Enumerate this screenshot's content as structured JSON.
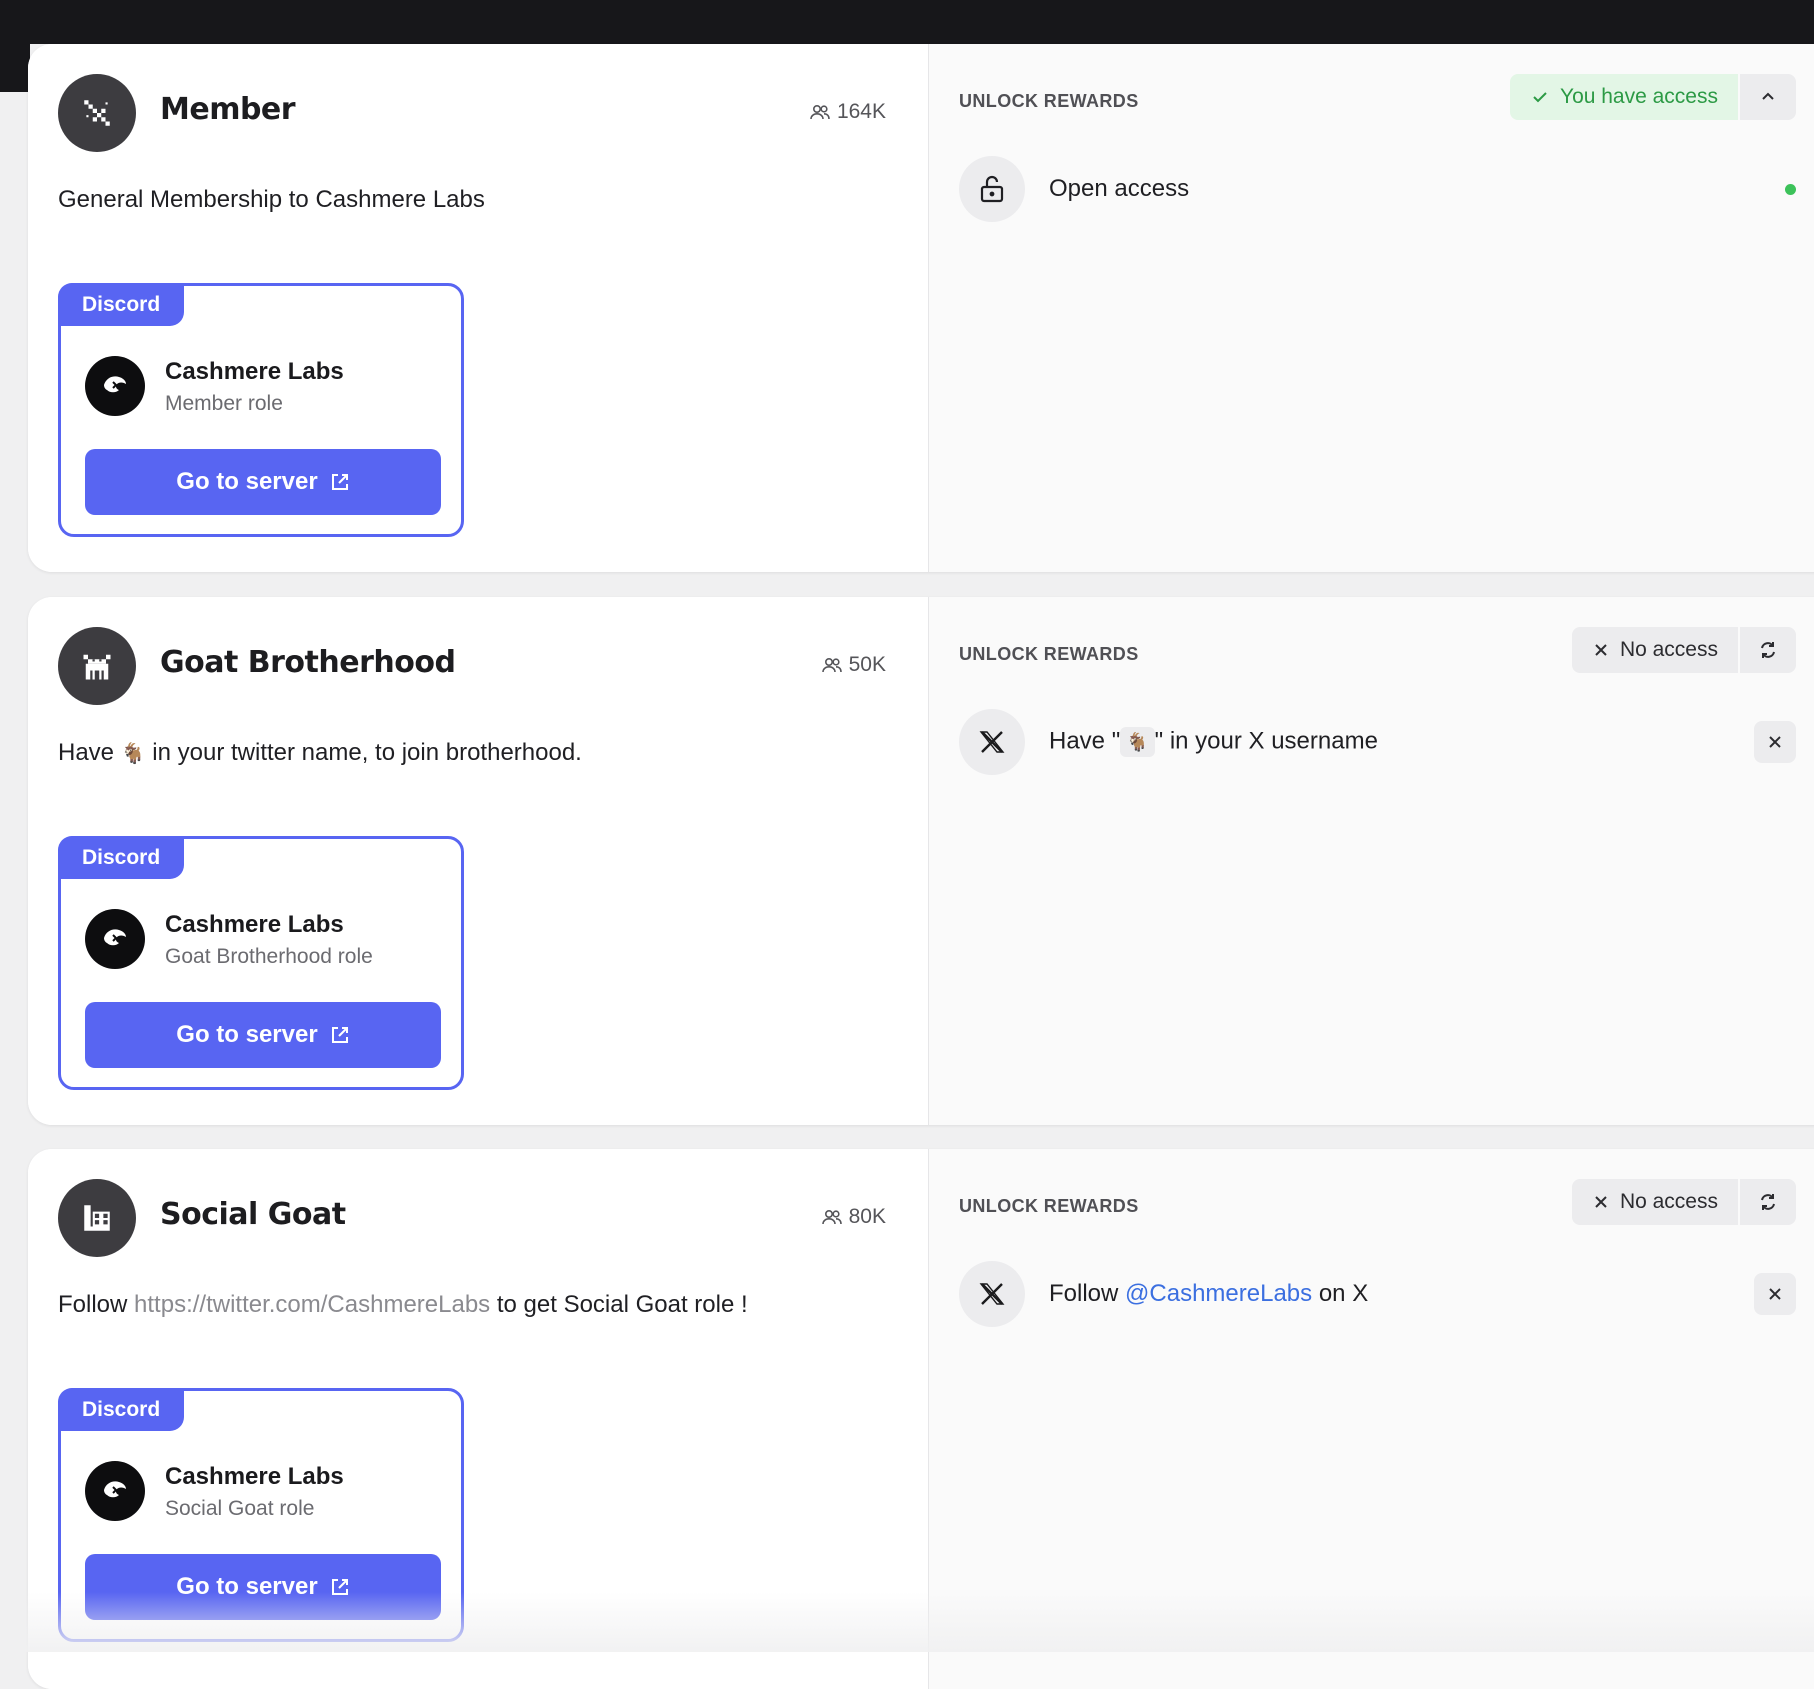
{
  "unlock_label": "UNLOCK REWARDS",
  "roles": [
    {
      "name": "Member",
      "member_count": "164K",
      "description": "General Membership to Cashmere Labs",
      "reward": {
        "platform": "Discord",
        "server_name": "Cashmere Labs",
        "server_role": "Member role",
        "button_label": "Go to server"
      },
      "status": {
        "kind": "access",
        "label": "You have access"
      },
      "requirement": {
        "type": "open",
        "text": "Open access"
      }
    },
    {
      "name": "Goat Brotherhood",
      "member_count": "50K",
      "description_before": "Have",
      "description_emoji": "🐐",
      "description_after": "in your twitter name, to join brotherhood.",
      "reward": {
        "platform": "Discord",
        "server_name": "Cashmere Labs",
        "server_role": "Goat Brotherhood role",
        "button_label": "Go to server"
      },
      "status": {
        "kind": "no-access",
        "label": "No access"
      },
      "requirement": {
        "type": "x",
        "text_before": "Have \"",
        "emoji": "🐐",
        "text_after": "\" in your X username"
      }
    },
    {
      "name": "Social Goat",
      "member_count": "80K",
      "description_before": "Follow",
      "description_link": "https://twitter.com/CashmereLabs",
      "description_after": "to get Social Goat role !",
      "reward": {
        "platform": "Discord",
        "server_name": "Cashmere Labs",
        "server_role": "Social Goat role",
        "button_label": "Go to server"
      },
      "status": {
        "kind": "no-access",
        "label": "No access"
      },
      "requirement": {
        "type": "x",
        "text_before": "Follow",
        "handle": "@CashmereLabs",
        "text_after": "on X"
      }
    }
  ]
}
